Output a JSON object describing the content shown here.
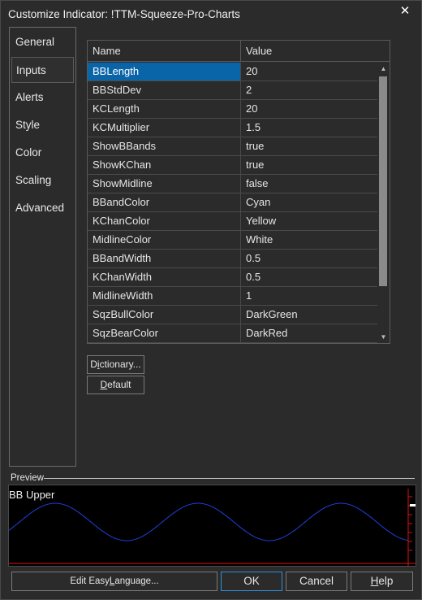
{
  "window": {
    "title": "Customize Indicator: !TTM-Squeeze-Pro-Charts",
    "close_glyph": "✕"
  },
  "sidebar": {
    "items": [
      {
        "label": "General",
        "active": false
      },
      {
        "label": "Inputs",
        "active": true
      },
      {
        "label": "Alerts",
        "active": false
      },
      {
        "label": "Style",
        "active": false
      },
      {
        "label": "Color",
        "active": false
      },
      {
        "label": "Scaling",
        "active": false
      },
      {
        "label": "Advanced",
        "active": false
      }
    ]
  },
  "inputs_grid": {
    "columns": [
      "Name",
      "Value"
    ],
    "selected_index": 0,
    "rows": [
      {
        "name": "BBLength",
        "value": "20"
      },
      {
        "name": "BBStdDev",
        "value": "2"
      },
      {
        "name": "KCLength",
        "value": "20"
      },
      {
        "name": "KCMultiplier",
        "value": "1.5"
      },
      {
        "name": "ShowBBands",
        "value": "true"
      },
      {
        "name": "ShowKChan",
        "value": "true"
      },
      {
        "name": "ShowMidline",
        "value": "false"
      },
      {
        "name": "BBandColor",
        "value": "Cyan"
      },
      {
        "name": "KChanColor",
        "value": "Yellow"
      },
      {
        "name": "MidlineColor",
        "value": "White"
      },
      {
        "name": "BBandWidth",
        "value": "0.5"
      },
      {
        "name": "KChanWidth",
        "value": "0.5"
      },
      {
        "name": "MidlineWidth",
        "value": "1"
      },
      {
        "name": "SqzBullColor",
        "value": "DarkGreen"
      },
      {
        "name": "SqzBearColor",
        "value": "DarkRed"
      }
    ]
  },
  "buttons": {
    "dictionary_pre": "D",
    "dictionary_u": "i",
    "dictionary_post": "ctionary...",
    "default_pre": "",
    "default_u": "D",
    "default_post": "efault",
    "edit_pre": "Edit Easy",
    "edit_u": "L",
    "edit_post": "anguage...",
    "ok": "OK",
    "cancel": "Cancel",
    "help_pre": "",
    "help_u": "H",
    "help_post": "elp"
  },
  "preview": {
    "label": "Preview",
    "plot_title": "BB Upper",
    "line_color": "#1f3fd9",
    "axis_color": "#e01010"
  },
  "colors": {
    "background": "#2b2b2b",
    "selection": "#0a64a8",
    "ok_border": "#2f8fd8"
  }
}
